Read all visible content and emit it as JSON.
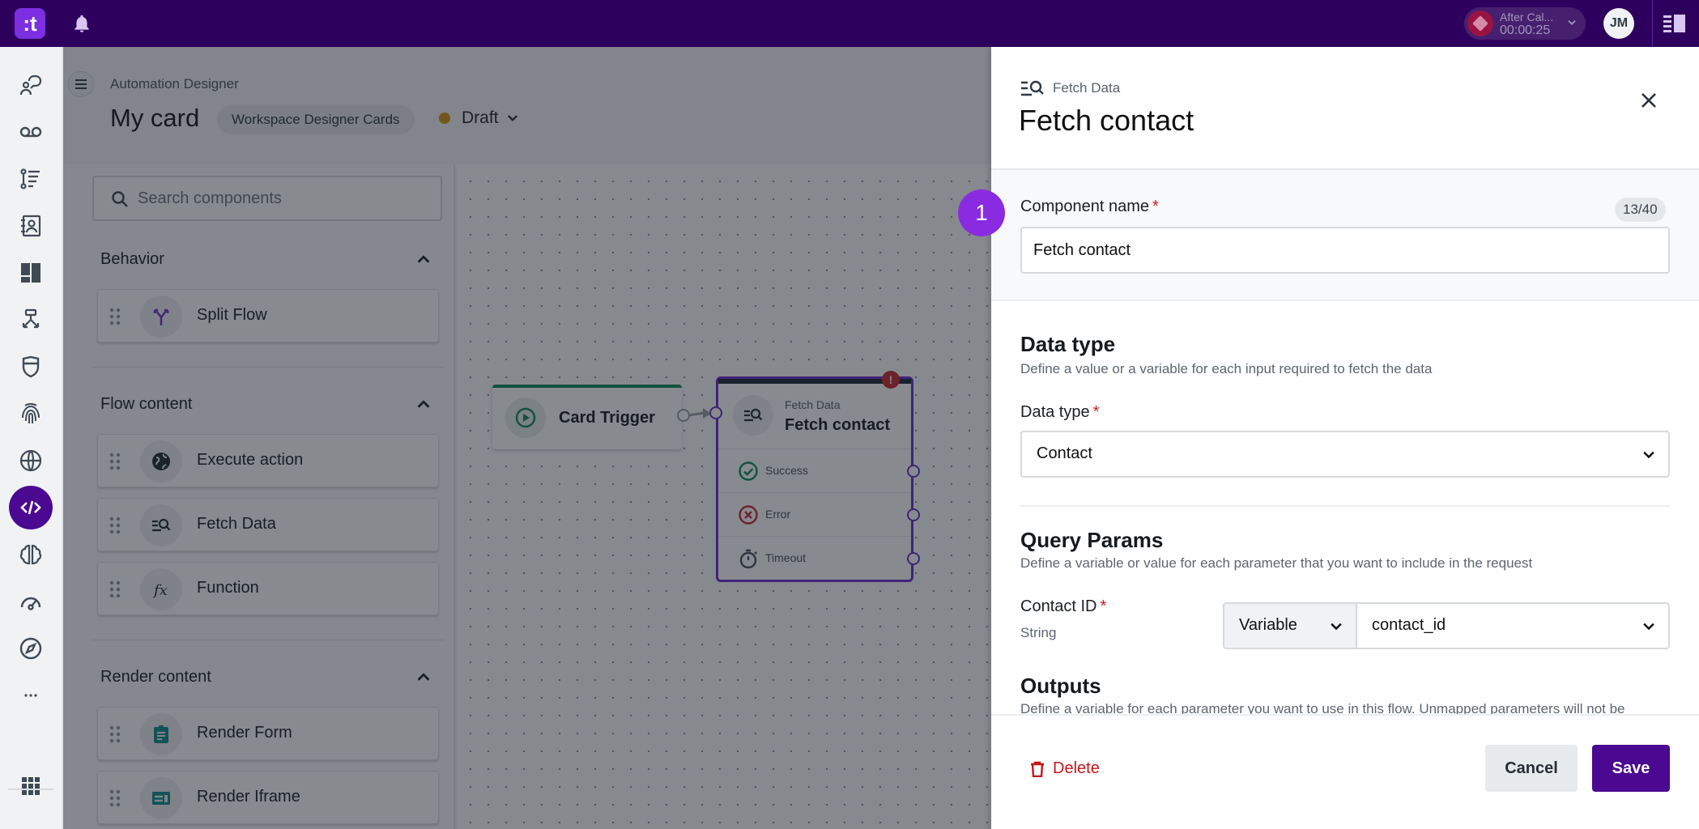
{
  "topbar": {
    "logo_text": ":t",
    "call_status": {
      "label": "After Cal...",
      "timer": "00:00:25"
    },
    "avatar_initials": "JM",
    "colors": {
      "bar": "#2d005d",
      "logo": "#7b2fe0"
    }
  },
  "rail": {
    "items": [
      {
        "icon": "agent-chat-icon",
        "active": false
      },
      {
        "icon": "voicemail-icon",
        "active": false
      },
      {
        "icon": "steps-list-icon",
        "active": false
      },
      {
        "icon": "contacts-book-icon",
        "active": false
      },
      {
        "icon": "dashboard-icon",
        "active": false
      },
      {
        "icon": "flow-split-icon",
        "active": false
      },
      {
        "icon": "shield-icon",
        "active": false
      },
      {
        "icon": "fingerprint-icon",
        "active": false
      },
      {
        "icon": "globe-icon",
        "active": false
      },
      {
        "icon": "code-icon",
        "active": true
      },
      {
        "icon": "brain-icon",
        "active": false
      },
      {
        "icon": "speedometer-icon",
        "active": false
      },
      {
        "icon": "compass-icon",
        "active": false
      },
      {
        "icon": "more-icon",
        "active": false
      }
    ],
    "apps_icon": "apps-grid-icon",
    "active_color": "#4b0891"
  },
  "header": {
    "breadcrumb": "Automation Designer",
    "title": "My card",
    "workspace_chip": "Workspace Designer Cards",
    "status": "Draft",
    "status_color": "#d49412"
  },
  "palette": {
    "search_placeholder": "Search components",
    "groups": [
      {
        "title": "Behavior",
        "items": [
          {
            "label": "Split Flow",
            "icon": "split-flow-icon"
          }
        ]
      },
      {
        "title": "Flow content",
        "items": [
          {
            "label": "Execute action",
            "icon": "globe-icon"
          },
          {
            "label": "Fetch Data",
            "icon": "fetch-data-icon"
          },
          {
            "label": "Function",
            "icon": "function-icon"
          }
        ]
      },
      {
        "title": "Render content",
        "items": [
          {
            "label": "Render Form",
            "icon": "form-icon"
          },
          {
            "label": "Render Iframe",
            "icon": "iframe-icon"
          }
        ]
      }
    ]
  },
  "canvas": {
    "trigger_node": {
      "label": "Card Trigger"
    },
    "fetch_node": {
      "kind": "Fetch Data",
      "title": "Fetch contact",
      "error_badge": "!",
      "outputs": [
        "Success",
        "Error",
        "Timeout"
      ]
    }
  },
  "drawer": {
    "kind": "Fetch Data",
    "title": "Fetch contact",
    "step_badge": "1",
    "component_name": {
      "label": "Component name",
      "required": "*",
      "counter": "13/40",
      "value": "Fetch contact"
    },
    "data_type_section": {
      "title": "Data type",
      "description": "Define a value or a variable for each input required to fetch the data",
      "field_label": "Data type",
      "required": "*",
      "value": "Contact"
    },
    "query_params": {
      "title": "Query Params",
      "description": "Define a variable or value for each parameter that you want to include in the request",
      "params": [
        {
          "label": "Contact ID",
          "required": "*",
          "type": "String",
          "mode": "Variable",
          "value": "contact_id"
        }
      ]
    },
    "outputs": {
      "title": "Outputs",
      "description": "Define a variable for each parameter you want to use in this flow. Unmapped parameters will not be"
    },
    "footer": {
      "delete_label": "Delete",
      "cancel_label": "Cancel",
      "save_label": "Save"
    }
  }
}
